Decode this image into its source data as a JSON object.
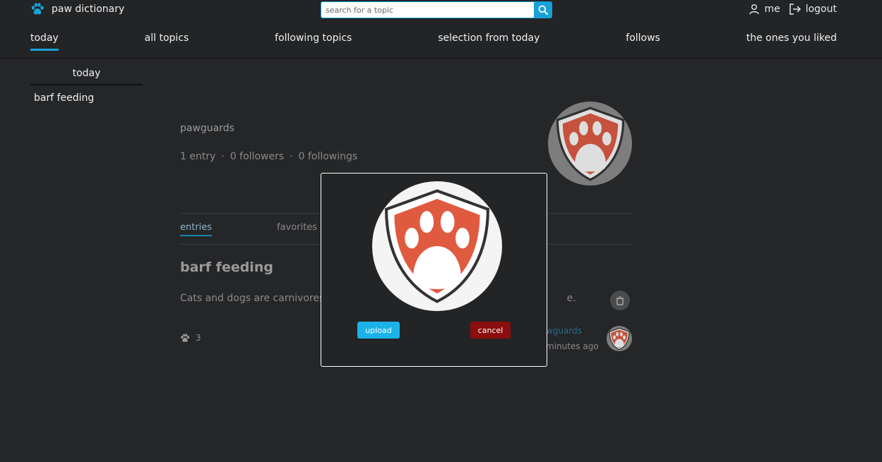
{
  "brand": {
    "name": "paw dictionary",
    "icon": "paw-icon"
  },
  "search": {
    "placeholder": "search for a topic",
    "value": ""
  },
  "user": {
    "me_label": "me",
    "logout_label": "logout"
  },
  "nav": {
    "tabs": [
      {
        "label": "today",
        "active": true
      },
      {
        "label": "all topics"
      },
      {
        "label": "following topics"
      },
      {
        "label": "selection from today"
      },
      {
        "label": "follows"
      },
      {
        "label": "the ones you liked"
      }
    ]
  },
  "sidebar": {
    "title": "today",
    "items": [
      {
        "label": "barf feeding"
      }
    ]
  },
  "profile": {
    "name": "pawguards",
    "entries": "1 entry",
    "followers": "0 followers",
    "followings": "0 followings",
    "separator": "·",
    "tabs": [
      {
        "label": "entries",
        "active": true
      },
      {
        "label": "favorites"
      }
    ]
  },
  "entry": {
    "title": "barf feeding",
    "text": "Cats and dogs are carnivores. th",
    "text_tail": "e.",
    "likes": "3",
    "author": "wguards",
    "time": "minutes ago"
  },
  "modal": {
    "upload_label": "upload",
    "cancel_label": "cancel"
  },
  "colors": {
    "accent": "#1aa1d8",
    "danger": "#8a0e0e",
    "background": "#252628",
    "logo_red": "#e05a40"
  }
}
